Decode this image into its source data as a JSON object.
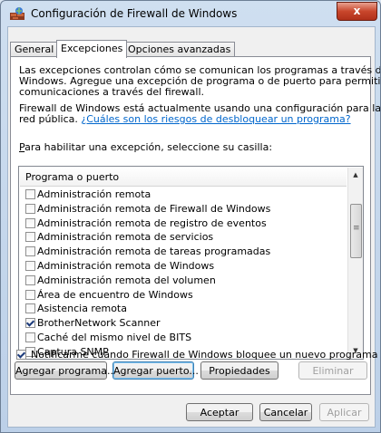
{
  "window": {
    "title": "Configuración de Firewall de Windows",
    "close_label": "x"
  },
  "tabs": [
    {
      "label": "General",
      "active": false
    },
    {
      "label": "Excepciones",
      "active": true
    },
    {
      "label": "Opciones avanzadas",
      "active": false
    }
  ],
  "intro": {
    "line1": "Las excepciones controlan cómo se comunican los programas a través del Firewall de",
    "line2": "Windows. Agregue una excepción de programa o de puerto para permitir las",
    "line3": "comunicaciones a través del firewall."
  },
  "status": {
    "line1": "Firewall de Windows está actualmente usando una configuración para la ubicación de",
    "line2_prefix": "red pública. ",
    "link": "¿Cuáles son los riesgos de desbloquear un programa?"
  },
  "instruction": {
    "underlined": "P",
    "rest": "ara habilitar una excepción, seleccione su casilla:"
  },
  "list": {
    "header": "Programa o puerto",
    "items": [
      {
        "label": "Administración remota",
        "checked": false
      },
      {
        "label": "Administración remota de Firewall de Windows",
        "checked": false
      },
      {
        "label": "Administración remota de registro de eventos",
        "checked": false
      },
      {
        "label": "Administración remota de servicios",
        "checked": false
      },
      {
        "label": "Administración remota de tareas programadas",
        "checked": false
      },
      {
        "label": "Administración remota de Windows",
        "checked": false
      },
      {
        "label": "Administración remota del volumen",
        "checked": false
      },
      {
        "label": "Área de encuentro de Windows",
        "checked": false
      },
      {
        "label": "Asistencia remota",
        "checked": false
      },
      {
        "label": "BrotherNetwork Scanner",
        "checked": true
      },
      {
        "label": "Caché del mismo nivel de BITS",
        "checked": false
      },
      {
        "label": "Captura SNMP",
        "checked": false
      }
    ]
  },
  "buttons": {
    "add_program": "Agregar programa...",
    "add_port": "Agregar puerto...",
    "properties": "Propiedades",
    "delete": "Eliminar",
    "accept": "Aceptar",
    "cancel": "Cancelar",
    "apply": "Aplicar"
  },
  "notify": {
    "label": "Notificarme cuando Firewall de Windows bloquee un nuevo programa",
    "checked": true
  },
  "colors": {
    "link": "#0066cc",
    "close_button": "#c8462c",
    "title_bar": "#cfdff0"
  }
}
